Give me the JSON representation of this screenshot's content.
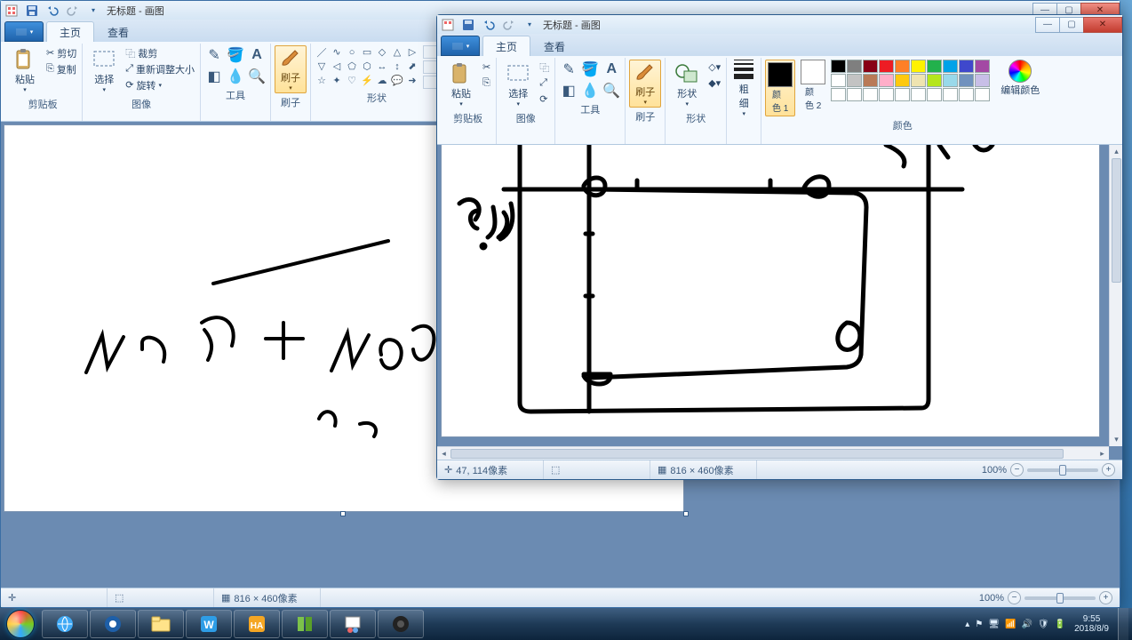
{
  "bg_window": {
    "title": "无标题 - 画图",
    "tabs": {
      "home": "主页",
      "view": "查看"
    },
    "groups": {
      "clipboard": {
        "label": "剪贴板",
        "paste": "粘贴",
        "cut": "剪切",
        "copy": "复制"
      },
      "image": {
        "label": "图像",
        "select": "选择",
        "crop": "裁剪",
        "resize": "重新调整大小",
        "rotate": "旋转"
      },
      "tools": {
        "label": "工具"
      },
      "brush": {
        "label": "刷子",
        "button": "刷子"
      },
      "shapes": {
        "label": "形状"
      }
    },
    "status": {
      "canvas_size": "816 × 460像素",
      "zoom": "100%"
    }
  },
  "fg_window": {
    "title": "无标题 - 画图",
    "tabs": {
      "home": "主页",
      "view": "查看"
    },
    "groups": {
      "clipboard": {
        "label": "剪贴板",
        "paste": "粘贴"
      },
      "image": {
        "label": "图像",
        "select": "选择"
      },
      "tools": {
        "label": "工具"
      },
      "brush": {
        "label": "刷子",
        "button": "刷子"
      },
      "shapes": {
        "label": "形状",
        "button": "形状"
      },
      "size": {
        "label": "粗细",
        "button": "粗\n细"
      },
      "colors": {
        "label": "颜色",
        "c1": "颜\n色 1",
        "c2": "颜\n色 2",
        "edit": "编辑颜色"
      }
    },
    "status": {
      "cursor": "47, 114像素",
      "canvas_size": "816 × 460像素",
      "zoom": "100%"
    }
  },
  "palette_colors": [
    "#000000",
    "#7f7f7f",
    "#880015",
    "#ed1c24",
    "#ff7f27",
    "#fff200",
    "#22b14c",
    "#00a2e8",
    "#3f48cc",
    "#a349a4",
    "#ffffff",
    "#c3c3c3",
    "#b97a57",
    "#ffaec9",
    "#ffc90e",
    "#efe4b0",
    "#b5e61d",
    "#99d9ea",
    "#7092be",
    "#c8bfe7",
    "#ffffff",
    "#ffffff",
    "#ffffff",
    "#ffffff",
    "#ffffff",
    "#ffffff",
    "#ffffff",
    "#ffffff",
    "#ffffff",
    "#ffffff"
  ],
  "taskbar": {
    "time": "9:55",
    "date": "2018/8/9"
  }
}
